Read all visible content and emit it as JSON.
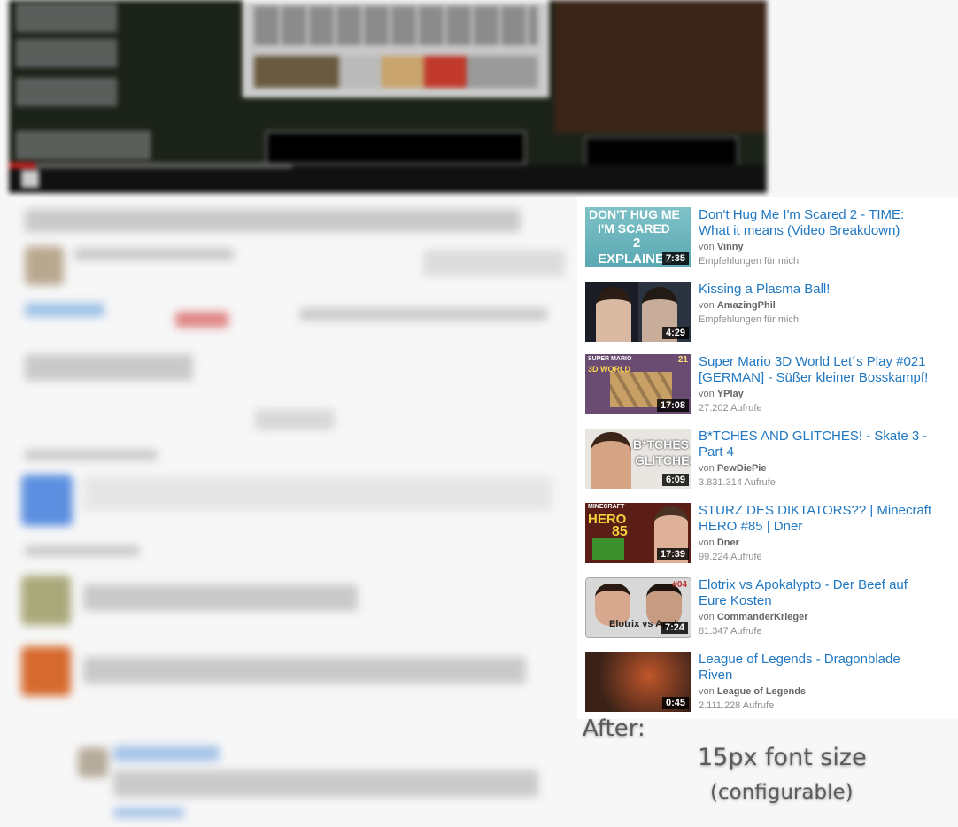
{
  "recommendations": [
    {
      "title": "Don't Hug Me I'm Scared 2 - TIME: What it means (Video Breakdown)",
      "channel": "Vinny",
      "meta": "Empfehlungen für mich",
      "duration": "7:35",
      "thumb_text_1": "DON'T HUG ME",
      "thumb_text_2": "I'M SCARED",
      "thumb_text_3": "2",
      "thumb_text_4": "EXPLAINED"
    },
    {
      "title": "Kissing a Plasma Ball!",
      "channel": "AmazingPhil",
      "meta": "Empfehlungen für mich",
      "duration": "4:29"
    },
    {
      "title": "Super Mario 3D World Let´s Play #021 [GERMAN] - Süßer kleiner Bosskampf!",
      "channel": "YPlay",
      "meta": "27.202 Aufrufe",
      "duration": "17:08",
      "thumb_text_1": "SUPER MARIO",
      "thumb_text_2": "3D WORLD",
      "thumb_text_3": "21"
    },
    {
      "title": "B*TCHES AND GLITCHES! - Skate 3 - Part 4",
      "channel": "PewDiePie",
      "meta": "3.831.314 Aufrufe",
      "duration": "6:09",
      "thumb_text_1": "B*TCHES",
      "thumb_text_2": "GLITCHES"
    },
    {
      "title": "STURZ DES DIKTATORS?? | Minecraft HERO #85 | Dner",
      "channel": "Dner",
      "meta": "99.224 Aufrufe",
      "duration": "17:39",
      "thumb_text_1": "MINECRAFT",
      "thumb_text_2": "HERO",
      "thumb_text_3": "85"
    },
    {
      "title": "Elotrix vs Apokalypto - Der Beef auf Eure Kosten",
      "channel": "CommanderKrieger",
      "meta": "81.347 Aufrufe",
      "duration": "7:24",
      "thumb_text_1": "#04",
      "thumb_text_2": "Elotrix vs Apok"
    },
    {
      "title": "League of Legends - Dragonblade Riven",
      "channel": "League of Legends",
      "meta": "2.111.228 Aufrufe",
      "duration": "0:45"
    }
  ],
  "by_prefix": "von",
  "annotation": {
    "after": "After:",
    "font_size": "15px font size",
    "configurable": "(configurable)"
  }
}
